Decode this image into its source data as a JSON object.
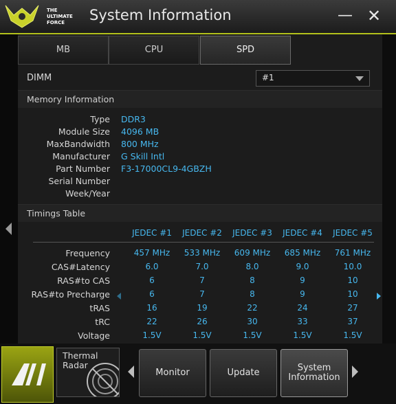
{
  "window": {
    "title": "System Information",
    "logo_text": "THE ULTIMATE FORCE"
  },
  "tabs": [
    {
      "label": "MB"
    },
    {
      "label": "CPU"
    },
    {
      "label": "SPD"
    }
  ],
  "dimm": {
    "label": "DIMM",
    "selected": "#1"
  },
  "memory": {
    "heading": "Memory Information",
    "rows": [
      {
        "key": "Type",
        "value": "DDR3"
      },
      {
        "key": "Module Size",
        "value": "4096 MB"
      },
      {
        "key": "MaxBandwidth",
        "value": "800 MHz"
      },
      {
        "key": "Manufacturer",
        "value": "G Skill Intl"
      },
      {
        "key": "Part Number",
        "value": "F3-17000CL9-4GBZH"
      },
      {
        "key": "Serial Number",
        "value": ""
      },
      {
        "key": "Week/Year",
        "value": ""
      }
    ]
  },
  "timings": {
    "heading": "Timings Table",
    "columns": [
      "JEDEC #1",
      "JEDEC #2",
      "JEDEC #3",
      "JEDEC #4",
      "JEDEC #5"
    ],
    "rows": [
      {
        "key": "Frequency",
        "values": [
          "457 MHz",
          "533 MHz",
          "609 MHz",
          "685 MHz",
          "761 MHz"
        ]
      },
      {
        "key": "CAS#Latency",
        "values": [
          "6.0",
          "7.0",
          "8.0",
          "9.0",
          "10.0"
        ]
      },
      {
        "key": "RAS#to CAS",
        "values": [
          "6",
          "7",
          "8",
          "9",
          "10"
        ]
      },
      {
        "key": "RAS#to Precharge",
        "values": [
          "6",
          "7",
          "8",
          "9",
          "10"
        ]
      },
      {
        "key": "tRAS",
        "values": [
          "16",
          "19",
          "22",
          "24",
          "27"
        ]
      },
      {
        "key": "tRC",
        "values": [
          "22",
          "26",
          "30",
          "33",
          "37"
        ]
      },
      {
        "key": "Voltage",
        "values": [
          "1.5V",
          "1.5V",
          "1.5V",
          "1.5V",
          "1.5V"
        ]
      }
    ]
  },
  "bottom": {
    "thermal_label_1": "Thermal",
    "thermal_label_2": "Radar",
    "buttons": [
      {
        "label": "Monitor"
      },
      {
        "label": "Update"
      },
      {
        "label_1": "System",
        "label_2": "Information"
      }
    ]
  },
  "colors": {
    "accent": "#b3c11b",
    "value_text": "#47b8ef"
  }
}
